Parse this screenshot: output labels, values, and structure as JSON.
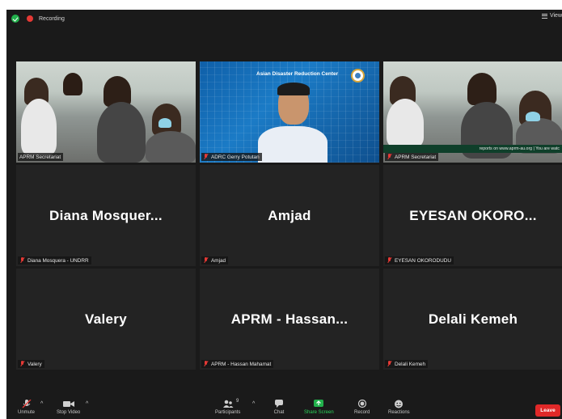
{
  "meeting": {
    "recording_label": "Recording",
    "view_label": "View"
  },
  "tiles": [
    {
      "name_label": "APRM Secretariat",
      "big_name": "",
      "type": "video-conference",
      "active": true
    },
    {
      "name_label": "ADRC Gerry Potutan",
      "big_name": "",
      "type": "video-presenter",
      "overlay_title": "Asian Disaster Reduction Center"
    },
    {
      "name_label": "APRM Secretariat",
      "big_name": "",
      "type": "video-conference",
      "ticker": "reports on www.aprm-au.org  |  You are watc"
    },
    {
      "name_label": "Diana Mosquera - UNDRR",
      "big_name": "Diana  Mosquer..."
    },
    {
      "name_label": "Amjad",
      "big_name": "Amjad"
    },
    {
      "name_label": "EYESAN OKORODUDU",
      "big_name": "EYESAN  OKORO..."
    },
    {
      "name_label": "Valery",
      "big_name": "Valery"
    },
    {
      "name_label": "APRM - Hassan Mahamat",
      "big_name": "APRM  -  Hassan..."
    },
    {
      "name_label": "Delali Kemeh",
      "big_name": "Delali Kemeh"
    }
  ],
  "toolbar": {
    "unmute_label": "Unmute",
    "stop_video_label": "Stop Video",
    "participants_label": "Participants",
    "participants_count": "9",
    "chat_label": "Chat",
    "share_screen_label": "Share Screen",
    "record_label": "Record",
    "reactions_label": "Reactions",
    "leave_label": "Leave"
  },
  "colors": {
    "active_speaker": "#cde04d",
    "share_screen": "#22b14c",
    "leave": "#e02828",
    "muted": "#e53935"
  }
}
